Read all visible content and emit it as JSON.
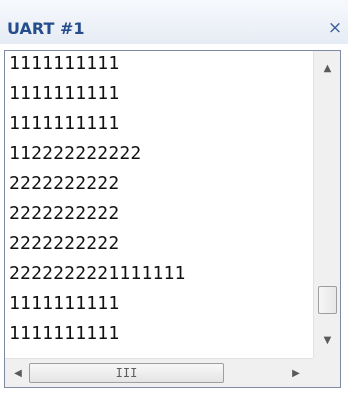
{
  "window": {
    "title": "UART #1",
    "close_glyph": "×"
  },
  "console": {
    "lines": [
      "1111111111",
      "1111111111",
      "1111111111",
      "112222222222",
      "2222222222",
      "2222222222",
      "2222222222",
      "2222222221111111",
      "1111111111",
      "1111111111"
    ]
  },
  "scrollbars": {
    "up_glyph": "▲",
    "down_glyph": "▼",
    "left_glyph": "◀",
    "right_glyph": "▶",
    "h_grip": "III"
  },
  "icons": {
    "close": "close-icon",
    "up": "scroll-up-arrow-icon",
    "down": "scroll-down-arrow-icon",
    "left": "scroll-left-arrow-icon",
    "right": "scroll-right-arrow-icon"
  },
  "colors": {
    "title_text": "#254d8c",
    "panel_border": "#7d8aa1"
  }
}
